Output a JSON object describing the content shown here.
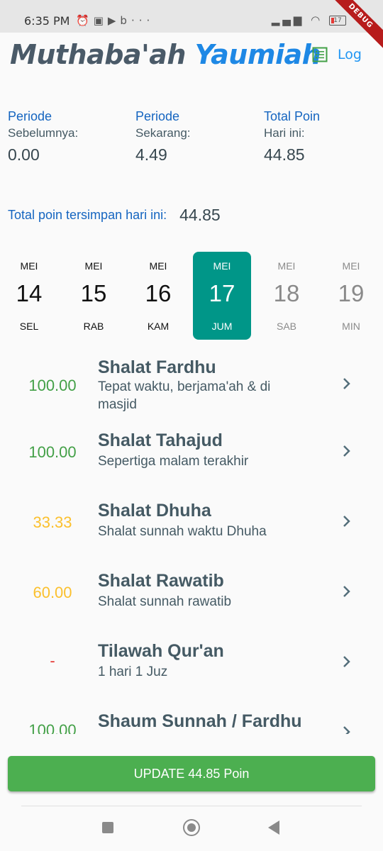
{
  "status_bar": {
    "time": "6:35 PM",
    "icons": [
      "alarm-icon",
      "shopee-icon",
      "video-icon",
      "b-icon",
      "more-icon"
    ],
    "right_icons": [
      "signal-icon",
      "wifi-icon",
      "battery-icon"
    ],
    "battery": "17"
  },
  "debug_banner": "DEBUG",
  "header": {
    "title_part1": "Muthaba'ah",
    "title_part2": "Yaumiah",
    "log_label": "Log",
    "log_icon": "list-icon",
    "colors": {
      "title_dark": "#4a5a68",
      "title_blue": "#1e88e5"
    }
  },
  "stats": [
    {
      "label1": "Periode",
      "label2": "Sebelumnya:",
      "value": "0.00"
    },
    {
      "label1": "Periode",
      "label2": "Sekarang:",
      "value": "4.49"
    },
    {
      "label1": "Total Poin",
      "label2": "Hari ini:",
      "value": "44.85"
    }
  ],
  "saved_points": {
    "label": "Total poin tersimpan hari ini:",
    "value": "44.85"
  },
  "days": [
    {
      "month": "MEI",
      "day": "14",
      "name": "SEL",
      "state": "past"
    },
    {
      "month": "MEI",
      "day": "15",
      "name": "RAB",
      "state": "past"
    },
    {
      "month": "MEI",
      "day": "16",
      "name": "KAM",
      "state": "past"
    },
    {
      "month": "MEI",
      "day": "17",
      "name": "JUM",
      "state": "selected"
    },
    {
      "month": "MEI",
      "day": "18",
      "name": "SAB",
      "state": "future"
    },
    {
      "month": "MEI",
      "day": "19",
      "name": "MIN",
      "state": "future"
    }
  ],
  "activities": [
    {
      "points": "100.00",
      "title": "Shalat Fardhu",
      "subtitle": "Tepat waktu, berjama'ah & di masjid",
      "color": "#43a047"
    },
    {
      "points": "100.00",
      "title": "Shalat Tahajud",
      "subtitle": "Sepertiga malam terakhir",
      "color": "#43a047"
    },
    {
      "points": "33.33",
      "title": "Shalat Dhuha",
      "subtitle": "Shalat sunnah waktu Dhuha",
      "color": "#fbc02d"
    },
    {
      "points": "60.00",
      "title": "Shalat Rawatib",
      "subtitle": "Shalat sunnah rawatib",
      "color": "#fbc02d"
    },
    {
      "points": "-",
      "title": "Tilawah Qur'an",
      "subtitle": "1 hari 1 Juz",
      "color": "#e53935"
    },
    {
      "points": "100.00",
      "title": "Shaum Sunnah / Fardhu",
      "subtitle": "",
      "color": "#43a047"
    }
  ],
  "update_button": "UPDATE 44.85 Poin",
  "colors": {
    "accent": "#009688",
    "button": "#4caf50",
    "label_blue": "#1565c0"
  }
}
